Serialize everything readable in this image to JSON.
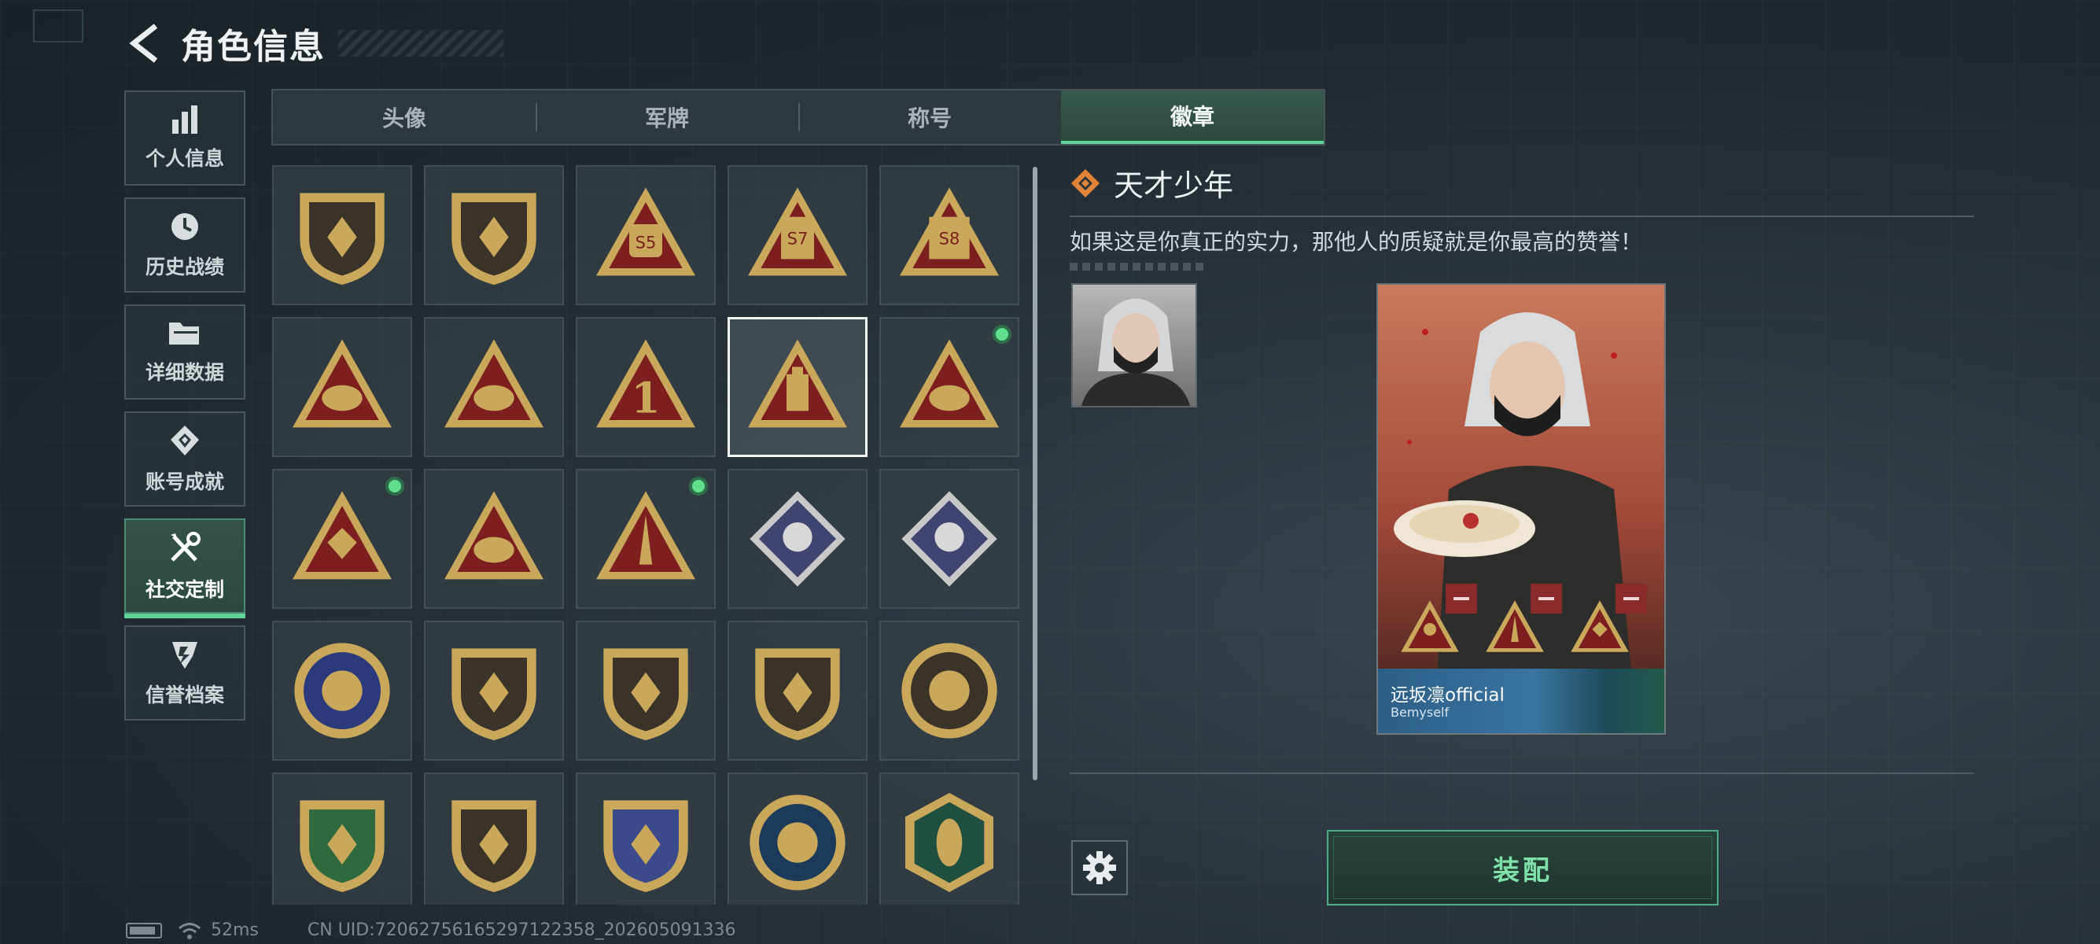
{
  "header": {
    "title": "角色信息"
  },
  "sidebar": {
    "items": [
      {
        "label": "个人信息",
        "icon": "bar-chart-icon",
        "active": false
      },
      {
        "label": "历史战绩",
        "icon": "history-clock-icon",
        "active": false
      },
      {
        "label": "详细数据",
        "icon": "folder-icon",
        "active": false
      },
      {
        "label": "账号成就",
        "icon": "achievement-icon",
        "active": false
      },
      {
        "label": "社交定制",
        "icon": "tools-icon",
        "active": true
      },
      {
        "label": "信誉档案",
        "icon": "reputation-icon",
        "active": false
      }
    ]
  },
  "tabs": [
    {
      "label": "头像",
      "active": false
    },
    {
      "label": "军牌",
      "active": false
    },
    {
      "label": "称号",
      "active": false
    },
    {
      "label": "徽章",
      "active": true
    }
  ],
  "badges": [
    {
      "icon": "delta-shield-badge-icon",
      "new": false,
      "selected": false
    },
    {
      "icon": "helicopter-shield-badge-icon",
      "new": false,
      "selected": false
    },
    {
      "icon": "s5-badge-icon",
      "new": false,
      "selected": false
    },
    {
      "icon": "s7-badge-icon",
      "new": false,
      "selected": false
    },
    {
      "icon": "s8-badge-icon",
      "new": false,
      "selected": false
    },
    {
      "icon": "dumpling-triangle-badge-icon",
      "new": false,
      "selected": false
    },
    {
      "icon": "tank-triangle-badge-icon",
      "new": false,
      "selected": false
    },
    {
      "icon": "number-one-triangle-badge-icon",
      "new": false,
      "selected": false
    },
    {
      "icon": "bottle-triangle-badge-icon",
      "new": false,
      "selected": true
    },
    {
      "icon": "figure-triangle-badge-icon",
      "new": true,
      "selected": false
    },
    {
      "icon": "dice-triangle-badge-icon",
      "new": true,
      "selected": false
    },
    {
      "icon": "soldier-triangle-badge-icon",
      "new": false,
      "selected": false
    },
    {
      "icon": "rocket-triangle-badge-icon",
      "new": true,
      "selected": false
    },
    {
      "icon": "rose-diamond-badge-icon",
      "new": false,
      "selected": false
    },
    {
      "icon": "launcher-diamond-badge-icon",
      "new": false,
      "selected": false
    },
    {
      "icon": "star-round-badge-icon",
      "new": false,
      "selected": false
    },
    {
      "icon": "gold-shield-badge-icon",
      "new": false,
      "selected": false
    },
    {
      "icon": "starred-shield-badge-icon",
      "new": false,
      "selected": false
    },
    {
      "icon": "gem-shield-badge-icon",
      "new": false,
      "selected": false
    },
    {
      "icon": "skull-round-badge-icon",
      "new": false,
      "selected": false
    },
    {
      "icon": "green-rifle-badge-icon",
      "new": false,
      "selected": false
    },
    {
      "icon": "rifle-shield-badge-icon",
      "new": false,
      "selected": false
    },
    {
      "icon": "blue-rifle-badge-icon",
      "new": false,
      "selected": false
    },
    {
      "icon": "eagle-round-badge-icon",
      "new": false,
      "selected": false
    },
    {
      "icon": "wasp-hex-badge-icon",
      "new": false,
      "selected": false
    }
  ],
  "detail": {
    "badge_name": "天才少年",
    "description": "如果这是你真正的实力，那他人的质疑就是你最高的赞誉！",
    "card": {
      "player_name": "远坂凛official",
      "signature": "Bemyself"
    },
    "equip_label": "装配"
  },
  "status": {
    "ping": "52ms",
    "uid": "CN UID:72062756165297122358_202605091336"
  },
  "colors": {
    "accent": "#5fd49a",
    "badge_gold": "#c9a85c",
    "badge_red": "#7d1f1f",
    "remove_red": "#8a2b2b"
  }
}
